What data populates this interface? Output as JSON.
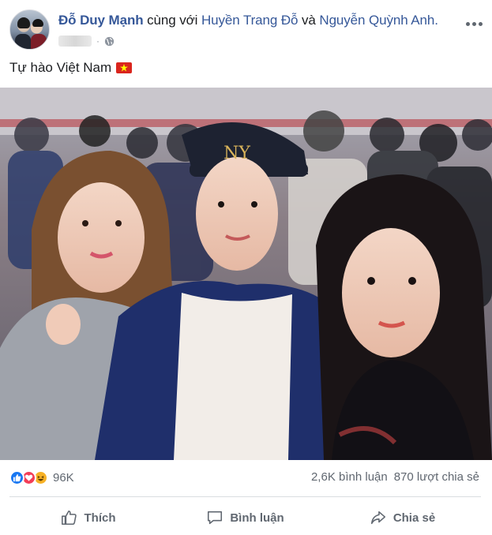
{
  "author": {
    "name": "Đỗ Duy Mạnh",
    "with_text": "cùng với",
    "tag1": "Huyền Trang Đỗ",
    "and_text": "và",
    "tag2": "Nguyễn Quỳnh Anh."
  },
  "privacy_icon": "globe-icon",
  "post_text": "Tự hào Việt Nam",
  "flag": "vietnam-flag",
  "reactions": {
    "types": [
      "like",
      "love",
      "haha"
    ],
    "count": "96K"
  },
  "stats": {
    "comments": "2,6K bình luận",
    "shares": "870 lượt chia sẻ"
  },
  "actions": {
    "like": "Thích",
    "comment": "Bình luận",
    "share": "Chia sẻ"
  },
  "colors": {
    "link": "#365899",
    "like_blue": "#1877f2",
    "love_red": "#f33e58",
    "haha_yellow": "#f7b125",
    "flag_red": "#da251d",
    "flag_star": "#ffff00"
  }
}
